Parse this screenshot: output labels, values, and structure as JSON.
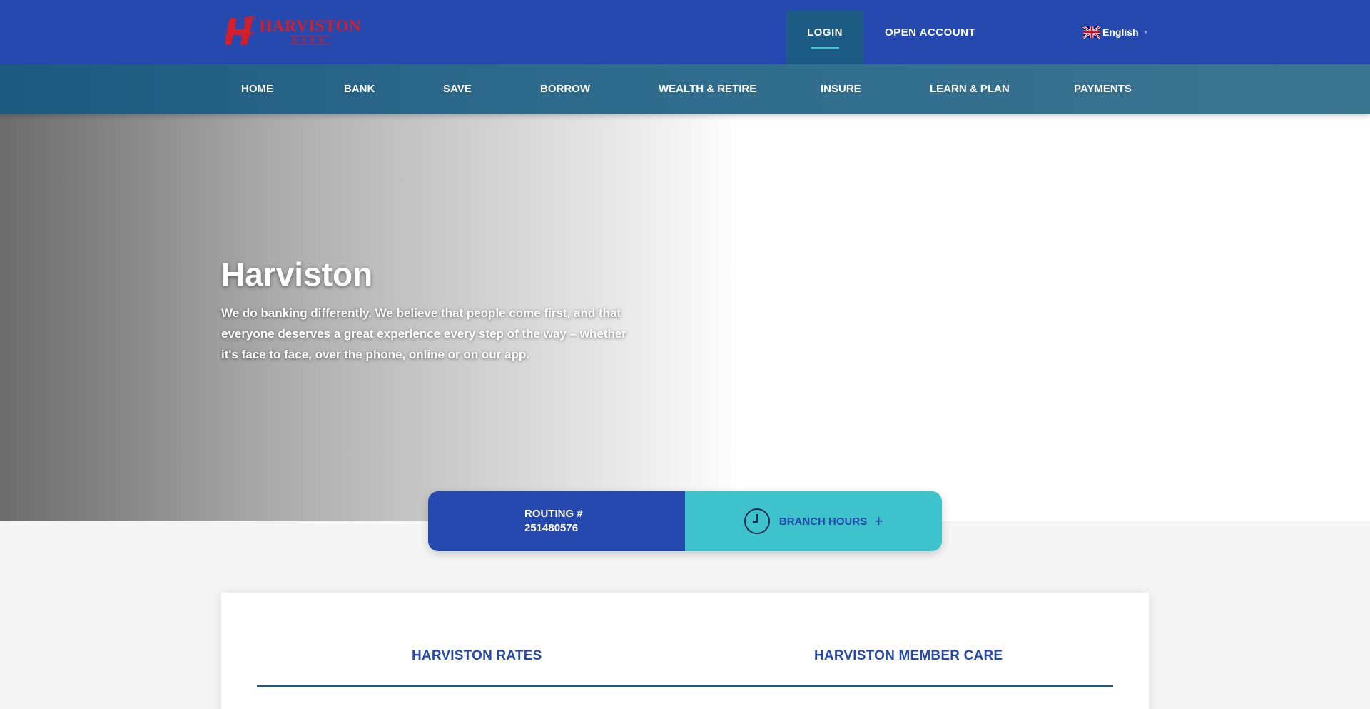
{
  "brand": {
    "name": "HARVISTON",
    "sub": "BANK",
    "brand_color": "#d21f2a"
  },
  "header": {
    "login_label": "LOGIN",
    "open_account_label": "OPEN ACCOUNT",
    "language_label": "English",
    "language_flag": "uk-flag-icon"
  },
  "nav": {
    "items": [
      {
        "label": "HOME"
      },
      {
        "label": "BANK"
      },
      {
        "label": "SAVE"
      },
      {
        "label": "BORROW"
      },
      {
        "label": "WEALTH & RETIRE"
      },
      {
        "label": "INSURE"
      },
      {
        "label": "LEARN & PLAN"
      },
      {
        "label": "PAYMENTS"
      }
    ]
  },
  "hero": {
    "title": "Harviston",
    "body": "We do banking differently. We believe that people come first, and that everyone deserves a great experience every step of the way – whether it's face to face, over the phone, online or on our app."
  },
  "info": {
    "routing_label": "ROUTING #",
    "routing_number": "251480576",
    "branch_hours_label": "BRANCH HOURS",
    "branch_icon": "clock-icon",
    "expand_icon": "plus-icon"
  },
  "card": {
    "tabs": [
      {
        "label": "HARVISTON RATES"
      },
      {
        "label": "HARVISTON MEMBER CARE"
      }
    ]
  },
  "colors": {
    "primary": "#2549ae",
    "accent": "#3ec3cc",
    "nav": "#1d5a7f"
  }
}
